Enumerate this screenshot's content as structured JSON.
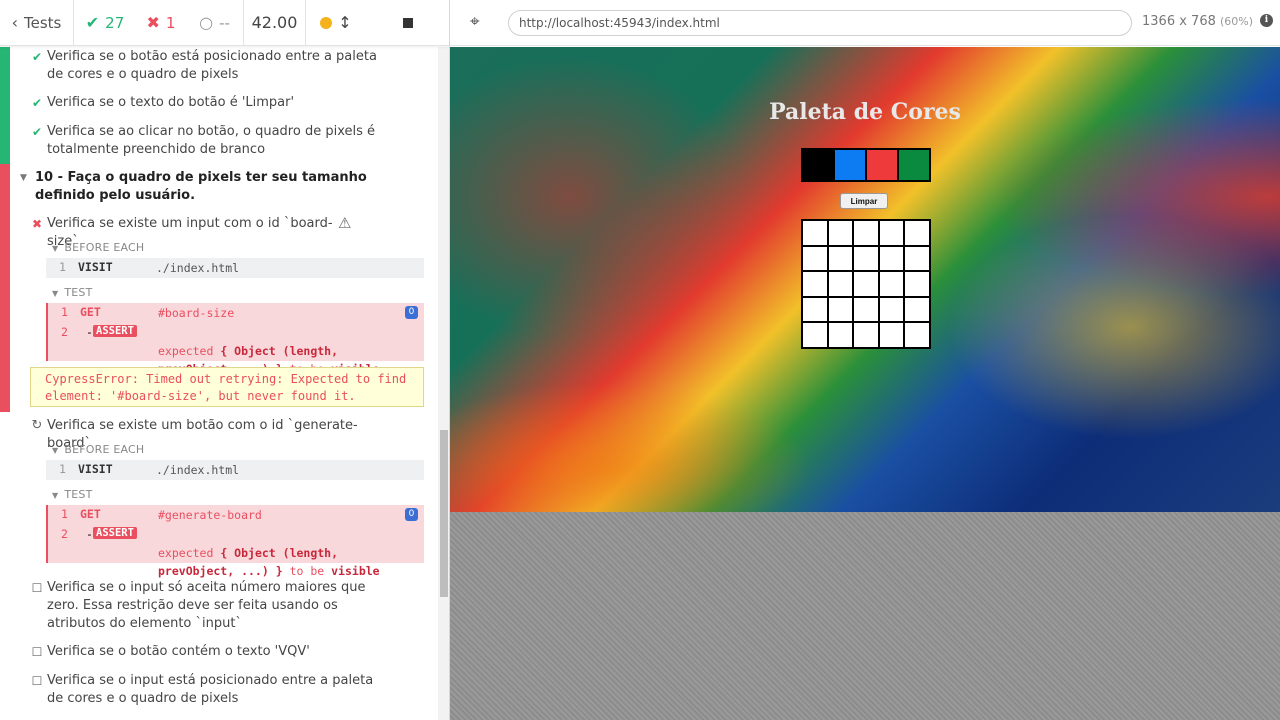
{
  "header": {
    "tests_label": "Tests",
    "passed": "27",
    "failed": "1",
    "pending": "--",
    "duration": "42.00"
  },
  "browser": {
    "url": "http://localhost:45943/index.html",
    "viewport": "1366 x 768",
    "scale": "(60%)"
  },
  "tests": {
    "t1": "Verifica se o botão está posicionado entre a paleta de cores e o quadro de pixels",
    "t2": "Verifica se o texto do botão é 'Limpar'",
    "t3": "Verifica se ao clicar no botão, o quadro de pixels é totalmente preenchido de branco",
    "suite10": "10 - Faça o quadro de pixels ter seu tamanho definido pelo usuário.",
    "t4": "Verifica se existe um input com o id `board-size`",
    "t5": "Verifica se existe um botão com o id `generate-board`",
    "t6": "Verifica se o input só aceita número maiores que zero. Essa restrição deve ser feita usando os atributos do elemento `input`",
    "t7": "Verifica se o botão contém o texto 'VQV'",
    "t8": "Verifica se o input está posicionado entre a paleta de cores e o quadro de pixels"
  },
  "hooks": {
    "before_each": "BEFORE EACH",
    "test": "TEST"
  },
  "commands": {
    "visit_num": "1",
    "visit_name": "VISIT",
    "visit_msg": "./index.html",
    "get_num": "1",
    "get_name": "GET",
    "get_msg_1": "#board-size",
    "get_msg_2": "#generate-board",
    "assert_num": "2",
    "assert_dash": "-",
    "assert_name": "ASSERT",
    "assert_expected": "expected",
    "assert_obj": "{ Object (length,",
    "assert_obj2": "prevObject, ...) }",
    "assert_tobe": "to be",
    "assert_visible": "visible",
    "count": "0"
  },
  "error": {
    "text": "CypressError: Timed out retrying: Expected to find element: '#board-size', but never found it."
  },
  "app": {
    "title": "Paleta de Cores",
    "clear_label": "Limpar",
    "palette": [
      "#000000",
      "#0d7cf2",
      "#ee3a3a",
      "#0a8a3e"
    ]
  },
  "colors": {
    "pass": "#26b574",
    "fail": "#e94f5f"
  }
}
